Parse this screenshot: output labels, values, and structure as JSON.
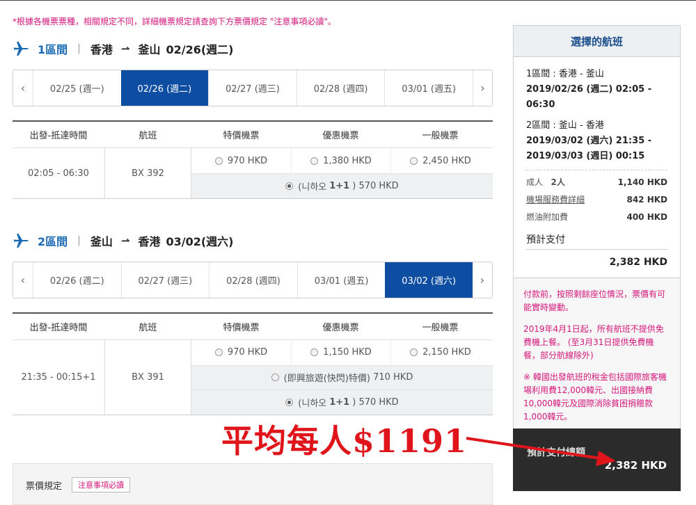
{
  "notice": "*根據各機票票種，相關規定不同，詳細機票規定請查詢下方票價規定 \"注意事項必讀\"。",
  "segments": [
    {
      "num": "1區間",
      "from": "香港",
      "to": "釜山",
      "date": "02/26(週二)",
      "days": [
        "02/25 (週一)",
        "02/26 (週二)",
        "02/27 (週三)",
        "02/28 (週四)",
        "03/01 (週五)"
      ],
      "active_index": 1,
      "headers": [
        "出發-抵達時間",
        "航班",
        "特價機票",
        "優惠機票",
        "一般機票"
      ],
      "time": "02:05 - 06:30",
      "flight": "BX 392",
      "prices": [
        "970 HKD",
        "1,380 HKD",
        "2,450 HKD"
      ],
      "promos": [
        {
          "label": "(니하오 ",
          "bold": "1+1",
          "suffix": ")",
          "price": "570 HKD",
          "selected": true
        }
      ]
    },
    {
      "num": "2區間",
      "from": "釜山",
      "to": "香港",
      "date": "03/02(週六)",
      "days": [
        "02/26 (週二)",
        "02/27 (週三)",
        "02/28 (週四)",
        "03/01 (週五)",
        "03/02 (週六)"
      ],
      "active_index": 4,
      "headers": [
        "出發-抵達時間",
        "航班",
        "特價機票",
        "優惠機票",
        "一般機票"
      ],
      "time": "21:35 - 00:15+1",
      "flight": "BX 391",
      "prices": [
        "970 HKD",
        "1,150 HKD",
        "2,150 HKD"
      ],
      "promos": [
        {
          "label": "(即興旅遊(快閃)特價)",
          "bold": "",
          "suffix": "",
          "price": "710 HKD",
          "selected": false
        },
        {
          "label": "(니하오 ",
          "bold": "1+1",
          "suffix": ")",
          "price": "570 HKD",
          "selected": true
        }
      ]
    }
  ],
  "rules": {
    "label": "票價規定",
    "button": "注意事項必讀"
  },
  "sidebar": {
    "title": "選擇的航班",
    "seg1": {
      "line1": "1區間 : 香港 - 釜山",
      "line2": "2019/02/26 (週二) 02:05 - 06:30"
    },
    "seg2": {
      "line1": "2區間 : 釜山 - 香港",
      "line2": "2019/03/02 (週六) 21:35 -",
      "line3": "2019/03/03 (週日) 00:15"
    },
    "costs": [
      {
        "label": "成人",
        "qty": "2人",
        "value": "1,140 HKD"
      },
      {
        "label": "機場服務費詳細",
        "qty": "",
        "value": "842 HKD"
      },
      {
        "label": "燃油附加費",
        "qty": "",
        "value": "400 HKD"
      }
    ],
    "pay_label": "預計支付",
    "pay_value": "2,382 HKD",
    "notes": [
      "付款前，按照剩餘座位情況，票價有可能實時變動。",
      "2019年4月1日起，所有航班不提供免費機上餐。 (至3月31日提供免費機餐，部分航線除外)",
      "※ 韓國出發航班的稅金包括國際旅客機場利用費12,000韓元、出國接納費10,000韓元及國際消除貧困捐贈款1,000韓元。"
    ]
  },
  "total": {
    "label": "預計支付總額",
    "value": "2,382 HKD"
  },
  "annotation": "平均每人$1191",
  "colors": {
    "brand_blue": "#0d4ea3",
    "notice_pink": "#d4177b",
    "annotation_red": "#e0151c"
  }
}
